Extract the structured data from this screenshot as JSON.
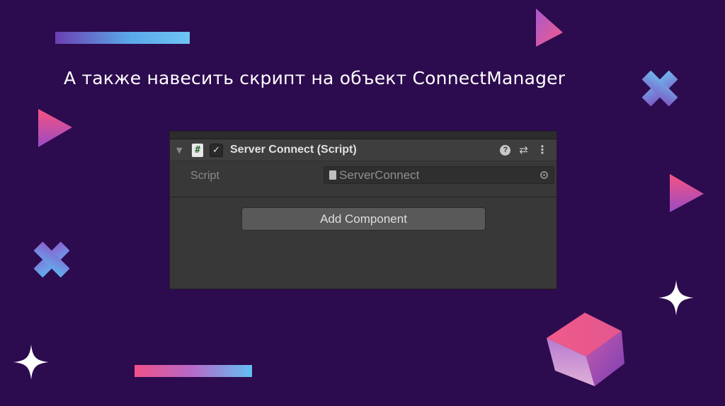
{
  "slide": {
    "title": "А также навесить скрипт на объект ConnectManager"
  },
  "inspector": {
    "component": {
      "title": "Server Connect (Script)",
      "enabled": true,
      "icons": [
        "foldout-arrow-icon",
        "csharp-script-icon",
        "checkbox-icon",
        "help-icon",
        "presets-icon",
        "kebab-menu-icon"
      ],
      "foldout_glyph": "▼",
      "script_glyph": "#",
      "check_glyph": "✓",
      "help_glyph": "?",
      "preset_glyph": "⇄",
      "menu_glyph": "⋮"
    },
    "properties": [
      {
        "label": "Script",
        "value": "ServerConnect"
      }
    ],
    "add_component_label": "Add Component"
  },
  "colors": {
    "background": "#2d0b4f",
    "panel": "#383838",
    "accent_pink": "#f0508a",
    "accent_blue": "#5aa8e8"
  }
}
